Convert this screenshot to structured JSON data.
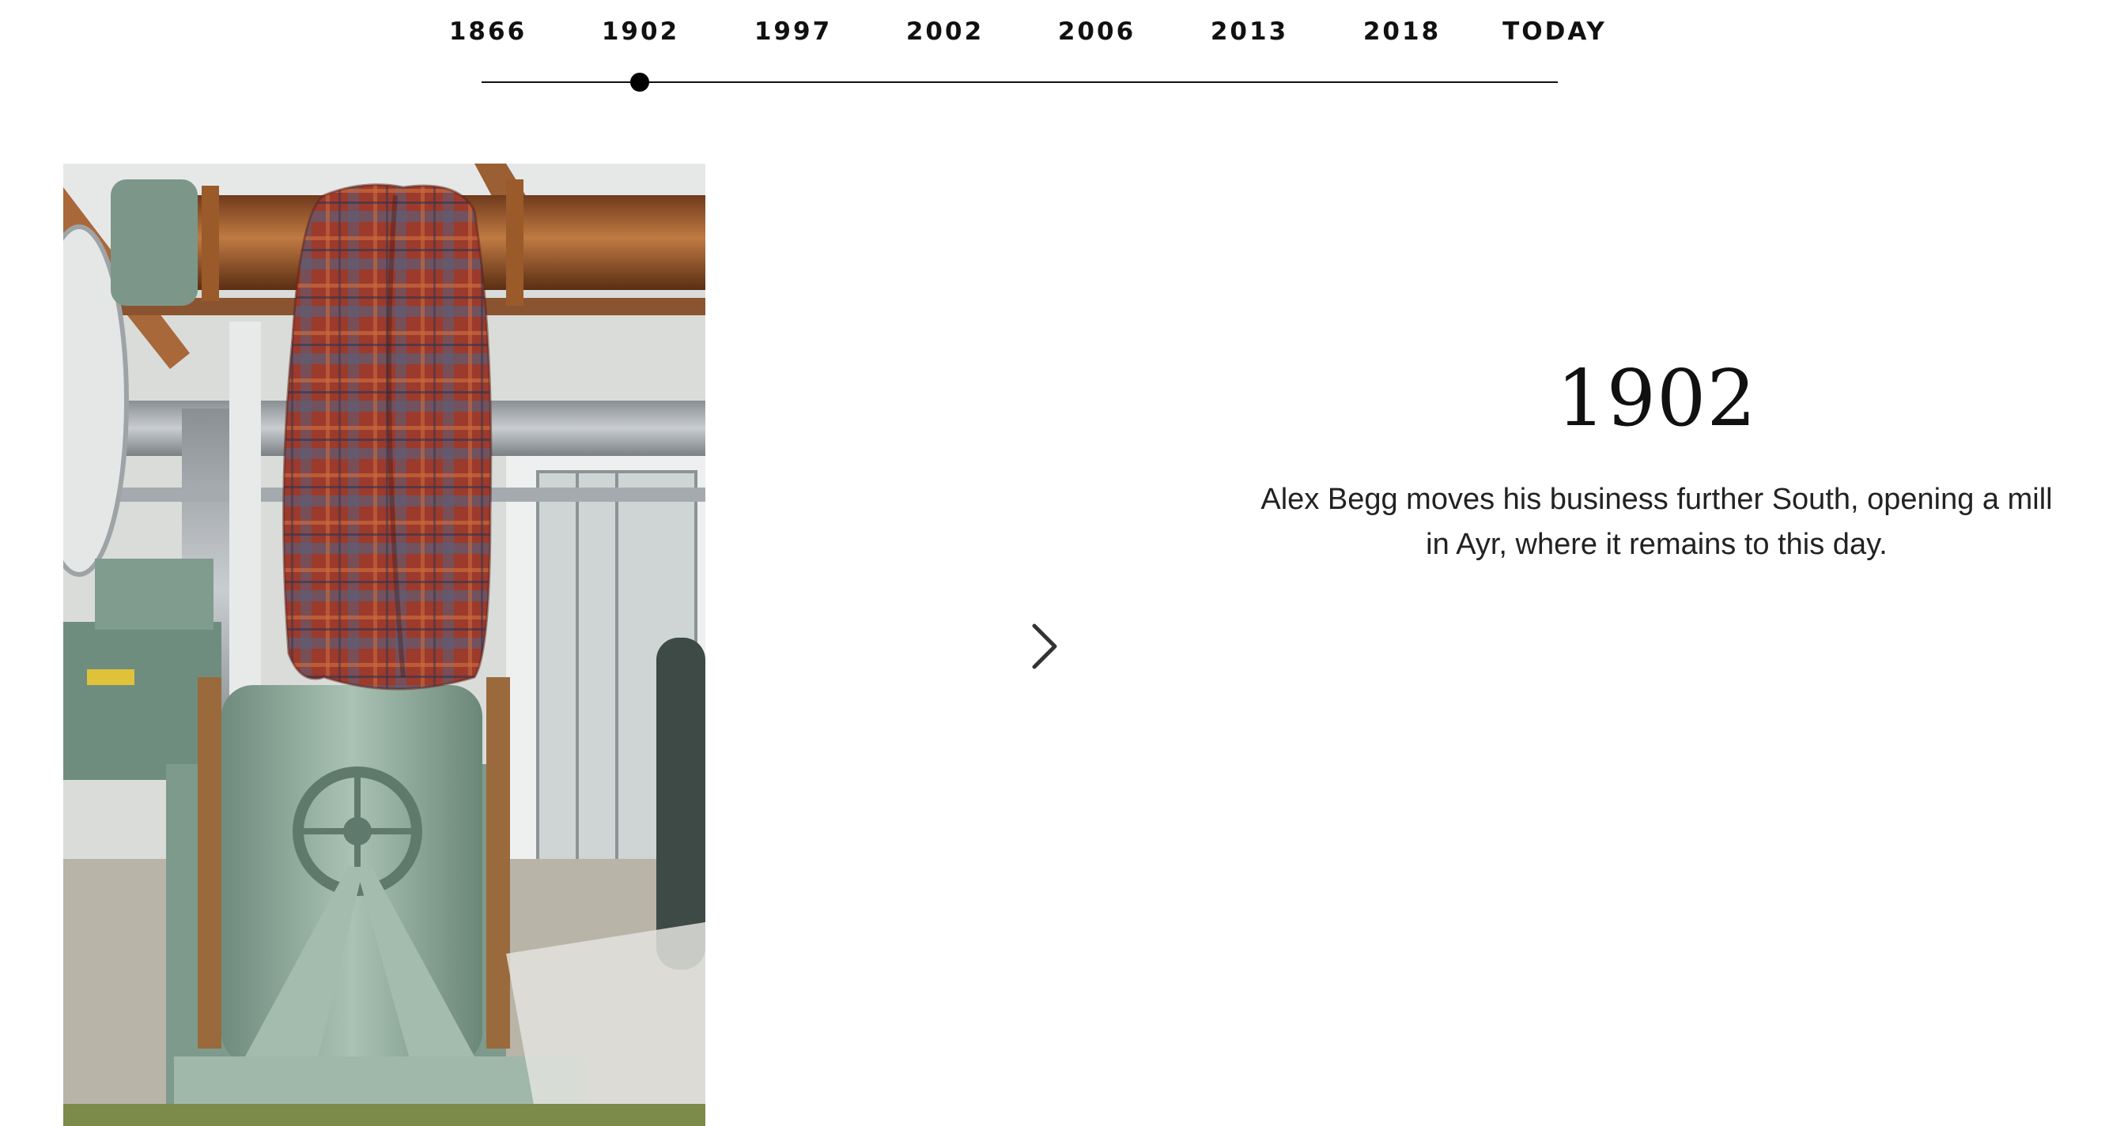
{
  "timeline": {
    "years": [
      {
        "label": "1866"
      },
      {
        "label": "1902"
      },
      {
        "label": "1997"
      },
      {
        "label": "2002"
      },
      {
        "label": "2006"
      },
      {
        "label": "2013"
      },
      {
        "label": "2018"
      },
      {
        "label": "TODAY"
      }
    ],
    "active": "1902"
  },
  "entry": {
    "year": "1902",
    "description": "Alex Begg moves his business further South, opening a mill in Ayr, where it remains to this day."
  },
  "navigation": {
    "next_icon": "chevron-right-icon"
  },
  "image": {
    "subject": "tartan-cloth-on-mill-machinery"
  },
  "colors": {
    "text": "#111111",
    "line": "#111111",
    "machine_green": "#8fa99a",
    "tartan_red": "#9c3a2c"
  }
}
